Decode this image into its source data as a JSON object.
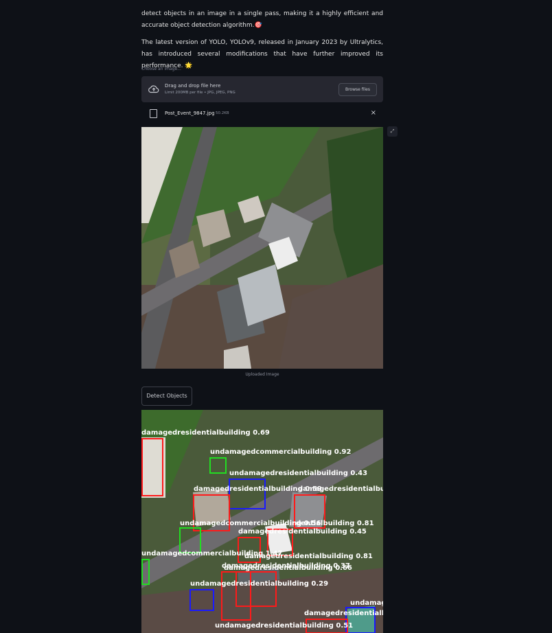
{
  "intro": {
    "p1": "detect objects in an image in a single pass, making it a highly efficient and accurate object detection algorithm.🎯",
    "p2": "The latest version of YOLO, YOLOv9, released in January 2023 by Ultralytics, has introduced several modifications that have further improved its performance. 🌟"
  },
  "uploader": {
    "label": "Choose an image...",
    "title": "Drag and drop file here",
    "subtitle": "Limit 200MB per file • JPG, JPEG, PNG",
    "browse_label": "Browse files"
  },
  "file": {
    "name": "Post_Event_9847.jpg",
    "size": "50.2KB",
    "close_glyph": "×"
  },
  "expand_glyph": "⤢",
  "uploaded_caption": "Uploaded Image",
  "detect_button": "Detect Objects",
  "detections": {
    "colors": {
      "damaged": "#ff1a1a",
      "undamaged_residential": "#1a1aff",
      "undamaged_commercial": "#22dd22"
    },
    "labels": [
      "damagedresidentialbuilding 0.69",
      "undamagedcommercialbuilding 0.92",
      "undamagedresidentialbuilding 0.43",
      "damagedresidentialbuilding 0.59",
      "damagedresidentialbuil",
      "undamagedcommercialbuilding 0.56",
      "dentialbuilding 0.81",
      "damagedresidentialbuilding 0.45",
      "undamagedcommercialbuilding 1.47",
      "damagedresidentialbuilding 0.81",
      "damagedresidentialbuilding 0.37",
      "damagedresidentialbuilding 0.66",
      "undamagedresidentialbuilding 0.29",
      "undamag",
      "damagedresidentialbu",
      "undamagedresidentialbuilding 0.51"
    ]
  }
}
